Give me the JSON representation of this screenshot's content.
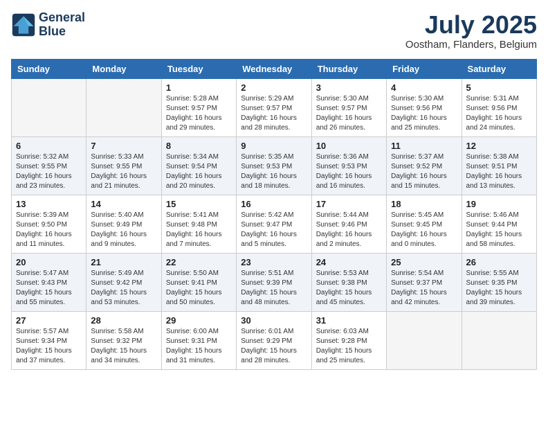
{
  "header": {
    "logo_line1": "General",
    "logo_line2": "Blue",
    "month_title": "July 2025",
    "location": "Oostham, Flanders, Belgium"
  },
  "weekdays": [
    "Sunday",
    "Monday",
    "Tuesday",
    "Wednesday",
    "Thursday",
    "Friday",
    "Saturday"
  ],
  "weeks": [
    [
      {
        "day": "",
        "info": ""
      },
      {
        "day": "",
        "info": ""
      },
      {
        "day": "1",
        "info": "Sunrise: 5:28 AM\nSunset: 9:57 PM\nDaylight: 16 hours and 29 minutes."
      },
      {
        "day": "2",
        "info": "Sunrise: 5:29 AM\nSunset: 9:57 PM\nDaylight: 16 hours and 28 minutes."
      },
      {
        "day": "3",
        "info": "Sunrise: 5:30 AM\nSunset: 9:57 PM\nDaylight: 16 hours and 26 minutes."
      },
      {
        "day": "4",
        "info": "Sunrise: 5:30 AM\nSunset: 9:56 PM\nDaylight: 16 hours and 25 minutes."
      },
      {
        "day": "5",
        "info": "Sunrise: 5:31 AM\nSunset: 9:56 PM\nDaylight: 16 hours and 24 minutes."
      }
    ],
    [
      {
        "day": "6",
        "info": "Sunrise: 5:32 AM\nSunset: 9:55 PM\nDaylight: 16 hours and 23 minutes."
      },
      {
        "day": "7",
        "info": "Sunrise: 5:33 AM\nSunset: 9:55 PM\nDaylight: 16 hours and 21 minutes."
      },
      {
        "day": "8",
        "info": "Sunrise: 5:34 AM\nSunset: 9:54 PM\nDaylight: 16 hours and 20 minutes."
      },
      {
        "day": "9",
        "info": "Sunrise: 5:35 AM\nSunset: 9:53 PM\nDaylight: 16 hours and 18 minutes."
      },
      {
        "day": "10",
        "info": "Sunrise: 5:36 AM\nSunset: 9:53 PM\nDaylight: 16 hours and 16 minutes."
      },
      {
        "day": "11",
        "info": "Sunrise: 5:37 AM\nSunset: 9:52 PM\nDaylight: 16 hours and 15 minutes."
      },
      {
        "day": "12",
        "info": "Sunrise: 5:38 AM\nSunset: 9:51 PM\nDaylight: 16 hours and 13 minutes."
      }
    ],
    [
      {
        "day": "13",
        "info": "Sunrise: 5:39 AM\nSunset: 9:50 PM\nDaylight: 16 hours and 11 minutes."
      },
      {
        "day": "14",
        "info": "Sunrise: 5:40 AM\nSunset: 9:49 PM\nDaylight: 16 hours and 9 minutes."
      },
      {
        "day": "15",
        "info": "Sunrise: 5:41 AM\nSunset: 9:48 PM\nDaylight: 16 hours and 7 minutes."
      },
      {
        "day": "16",
        "info": "Sunrise: 5:42 AM\nSunset: 9:47 PM\nDaylight: 16 hours and 5 minutes."
      },
      {
        "day": "17",
        "info": "Sunrise: 5:44 AM\nSunset: 9:46 PM\nDaylight: 16 hours and 2 minutes."
      },
      {
        "day": "18",
        "info": "Sunrise: 5:45 AM\nSunset: 9:45 PM\nDaylight: 16 hours and 0 minutes."
      },
      {
        "day": "19",
        "info": "Sunrise: 5:46 AM\nSunset: 9:44 PM\nDaylight: 15 hours and 58 minutes."
      }
    ],
    [
      {
        "day": "20",
        "info": "Sunrise: 5:47 AM\nSunset: 9:43 PM\nDaylight: 15 hours and 55 minutes."
      },
      {
        "day": "21",
        "info": "Sunrise: 5:49 AM\nSunset: 9:42 PM\nDaylight: 15 hours and 53 minutes."
      },
      {
        "day": "22",
        "info": "Sunrise: 5:50 AM\nSunset: 9:41 PM\nDaylight: 15 hours and 50 minutes."
      },
      {
        "day": "23",
        "info": "Sunrise: 5:51 AM\nSunset: 9:39 PM\nDaylight: 15 hours and 48 minutes."
      },
      {
        "day": "24",
        "info": "Sunrise: 5:53 AM\nSunset: 9:38 PM\nDaylight: 15 hours and 45 minutes."
      },
      {
        "day": "25",
        "info": "Sunrise: 5:54 AM\nSunset: 9:37 PM\nDaylight: 15 hours and 42 minutes."
      },
      {
        "day": "26",
        "info": "Sunrise: 5:55 AM\nSunset: 9:35 PM\nDaylight: 15 hours and 39 minutes."
      }
    ],
    [
      {
        "day": "27",
        "info": "Sunrise: 5:57 AM\nSunset: 9:34 PM\nDaylight: 15 hours and 37 minutes."
      },
      {
        "day": "28",
        "info": "Sunrise: 5:58 AM\nSunset: 9:32 PM\nDaylight: 15 hours and 34 minutes."
      },
      {
        "day": "29",
        "info": "Sunrise: 6:00 AM\nSunset: 9:31 PM\nDaylight: 15 hours and 31 minutes."
      },
      {
        "day": "30",
        "info": "Sunrise: 6:01 AM\nSunset: 9:29 PM\nDaylight: 15 hours and 28 minutes."
      },
      {
        "day": "31",
        "info": "Sunrise: 6:03 AM\nSunset: 9:28 PM\nDaylight: 15 hours and 25 minutes."
      },
      {
        "day": "",
        "info": ""
      },
      {
        "day": "",
        "info": ""
      }
    ]
  ]
}
